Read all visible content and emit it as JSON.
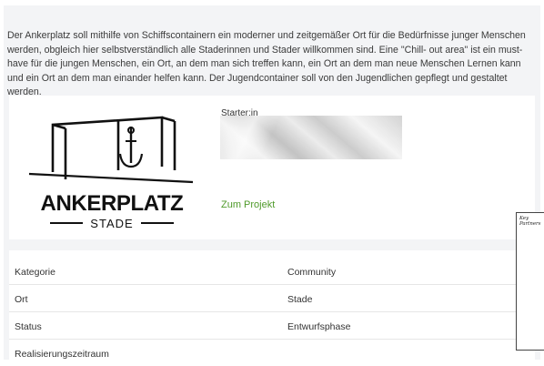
{
  "description": "Der Ankerplatz soll mithilfe von Schiffscontainern ein moderner und zeitgemäßer Ort für die Bedürfnisse junger Menschen werden, obgleich hier selbstverständlich alle Staderinnen und Stader willkommen sind. Eine \"Chill- out area\" ist ein must-have für die jungen Menschen, ein Ort, an dem man sich treffen kann, ein Ort an dem man neue Menschen Lernen kann und ein Ort an dem man einander helfen kann. Der Jugendcontainer soll von den Jugendlichen gepflegt und gestaltet werden.",
  "logo": {
    "title": "ANKERPLATZ",
    "subtitle": "STADE"
  },
  "starter": {
    "label": "Starter:in"
  },
  "project_link": "Zum Projekt",
  "details": [
    {
      "key": "Kategorie",
      "value": "Community"
    },
    {
      "key": "Ort",
      "value": "Stade"
    },
    {
      "key": "Status",
      "value": "Entwurfsphase"
    },
    {
      "key": "Realisierungszeitraum",
      "value": ""
    }
  ],
  "side_panel": {
    "label_line1": "Key",
    "label_line2": "Partners"
  },
  "colors": {
    "background": "#f3f4f6",
    "link": "#4f9a2a"
  }
}
